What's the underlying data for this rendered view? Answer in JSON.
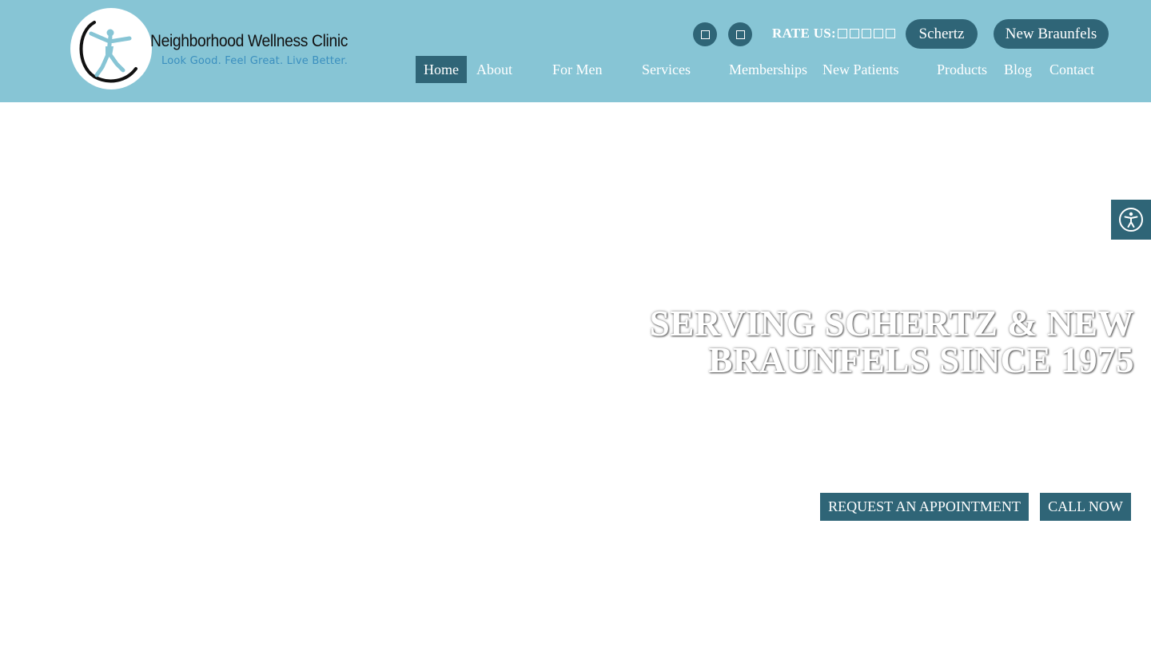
{
  "header": {
    "brand": {
      "name": "Neighborhood Wellness Clinic",
      "tagline": "Look Good. Feel Great. Live Better."
    },
    "social_icons": [
      "social-icon-1",
      "social-icon-2"
    ],
    "rate_us": {
      "label": "RATE US:",
      "stars": 5
    },
    "locations": [
      {
        "label": "Schertz"
      },
      {
        "label": "New Braunfels"
      }
    ],
    "nav": [
      {
        "label": "Home",
        "active": true
      },
      {
        "label": "About"
      },
      {
        "label": "For Men"
      },
      {
        "label": "Services"
      },
      {
        "label": "Memberships"
      },
      {
        "label": "New Patients"
      },
      {
        "label": "Products"
      },
      {
        "label": "Blog"
      },
      {
        "label": "Contact"
      }
    ]
  },
  "hero": {
    "title_line1": "SERVING SCHERTZ & NEW",
    "title_line2": "BRAUNFELS SINCE 1975",
    "buttons": {
      "appointment": "REQUEST AN APPOINTMENT",
      "call": "CALL NOW"
    }
  },
  "accessibility": {
    "icon": "accessibility-icon"
  },
  "colors": {
    "header_bg": "#87c5d5",
    "accent_dark": "#2f6577",
    "tagline": "#3a8fbf",
    "text_light": "#ffffff"
  }
}
